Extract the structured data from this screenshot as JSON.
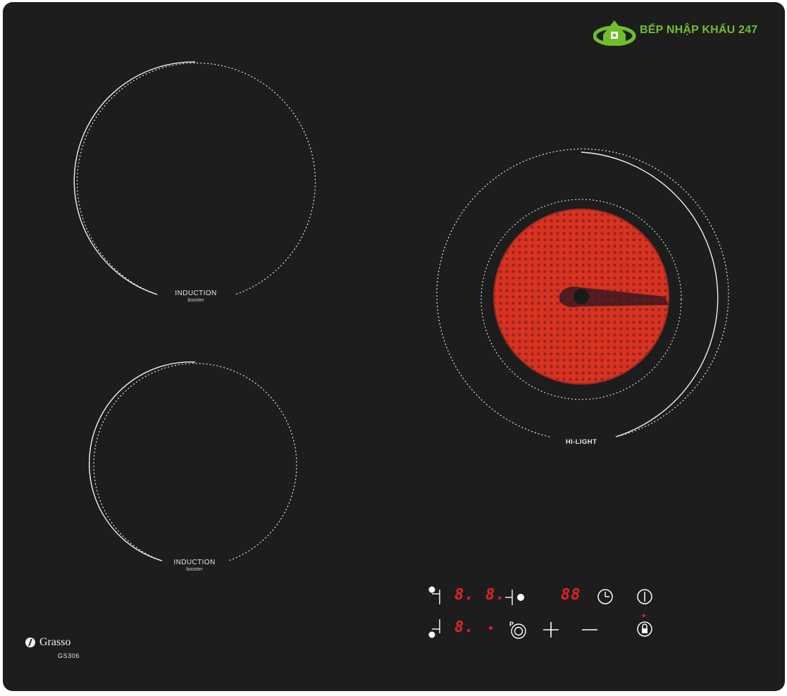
{
  "watermark": {
    "text": "BẾP NHẬP KHẨU 247"
  },
  "zones": [
    {
      "id": "front-left",
      "label": "INDUCTION",
      "sub": "booster"
    },
    {
      "id": "rear-left",
      "label": "INDUCTION",
      "sub": "booster"
    },
    {
      "id": "right",
      "label": "HI-LIGHT"
    }
  ],
  "brand": {
    "name": "Grasso",
    "model": "GS306"
  },
  "displays": {
    "zone1": "8.",
    "zone2": "8.",
    "zone3": "8.",
    "timer": "88"
  },
  "controls": {
    "zone_select_left": "zone-select-rear-left",
    "zone_select_right": "zone-select-right",
    "zone_select_front": "zone-select-front-left",
    "timer_icon": "clock-icon",
    "power_icon": "power-icon",
    "booster_icon": "booster-p-icon",
    "plus_icon": "plus-icon",
    "minus_icon": "minus-icon",
    "lock_icon": "lock-icon"
  },
  "colors": {
    "glass": "#1d1d1d",
    "digit_red": "#e3202c",
    "watermark_green": "#6fbf2a",
    "element_red": "#d9331f"
  }
}
